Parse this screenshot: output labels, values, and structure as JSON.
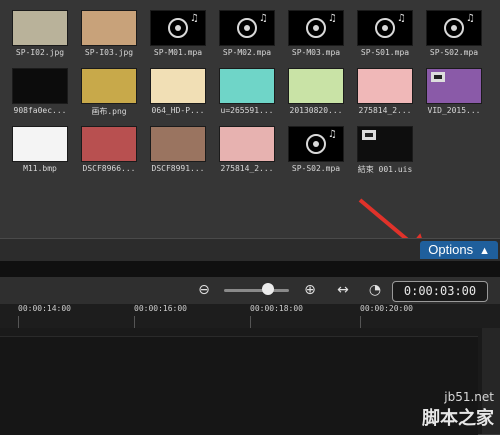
{
  "library": {
    "items": [
      {
        "label": "SP-I02.jpg",
        "kind": "image",
        "color": "#b9b29a"
      },
      {
        "label": "SP-I03.jpg",
        "kind": "image",
        "color": "#c8a27a"
      },
      {
        "label": "SP-M01.mpa",
        "kind": "audio"
      },
      {
        "label": "SP-M02.mpa",
        "kind": "audio"
      },
      {
        "label": "SP-M03.mpa",
        "kind": "audio"
      },
      {
        "label": "SP-S01.mpa",
        "kind": "audio"
      },
      {
        "label": "SP-S02.mpa",
        "kind": "audio"
      },
      {
        "label": "908fa0ec...",
        "kind": "image",
        "color": "#0c0c0c"
      },
      {
        "label": "画布.png",
        "kind": "image",
        "color": "#c8a94a"
      },
      {
        "label": "064_HD-P...",
        "kind": "image",
        "color": "#f1dfb5"
      },
      {
        "label": "u=265591...",
        "kind": "image",
        "color": "#6fd5c8"
      },
      {
        "label": "20130820...",
        "kind": "image",
        "color": "#c9e3a6"
      },
      {
        "label": "275814_2...",
        "kind": "image",
        "color": "#f0b8b8"
      },
      {
        "label": "VID_2015...",
        "kind": "video",
        "color": "#8a5aa8"
      },
      {
        "label": "M11.bmp",
        "kind": "image",
        "color": "#f4f4f4"
      },
      {
        "label": "DSCF8966...",
        "kind": "image",
        "color": "#b85050"
      },
      {
        "label": "DSCF8991...",
        "kind": "image",
        "color": "#9a7460"
      },
      {
        "label": "275814_2...",
        "kind": "image",
        "color": "#e7b2b0"
      },
      {
        "label": "SP-S02.mpa",
        "kind": "audio"
      },
      {
        "label": "結束 001.uis",
        "kind": "video",
        "color": "#0e0e0e"
      }
    ]
  },
  "options": {
    "label": "Options",
    "chevron": "chevron-up-icon"
  },
  "toolbar": {
    "zoom_out_icon": "zoom-out-icon",
    "zoom_in_icon": "zoom-in-icon",
    "fit_icon": "fit-to-window-icon",
    "clock_icon": "clock-icon",
    "timecode": "0:00:03:00"
  },
  "ruler": {
    "ticks": [
      "00:00:14:00",
      "00:00:16:00",
      "00:00:18:00",
      "00:00:20:00"
    ]
  },
  "watermark": {
    "line1": "jb51.net",
    "line2": "脚本之家"
  },
  "colors": {
    "accent": "#1f5f9c",
    "arrow": "#e0322a"
  }
}
